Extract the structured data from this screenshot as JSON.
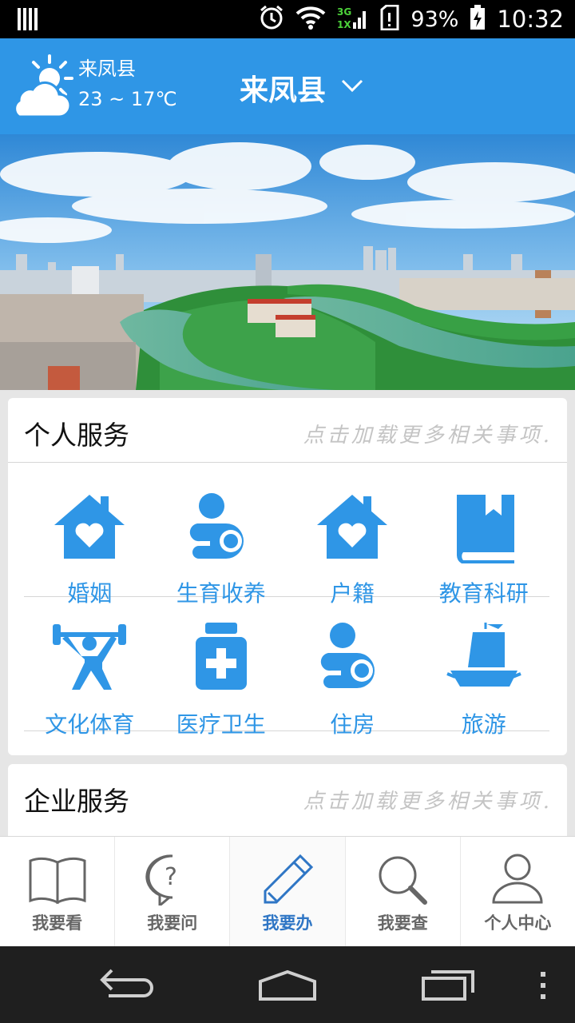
{
  "status_bar": {
    "network": "3G 1X",
    "battery": "93%",
    "time": "10:32"
  },
  "header": {
    "weather": {
      "city": "来凤县",
      "temp": "23 ~ 17℃",
      "icon": "partly-cloudy-icon"
    },
    "location": {
      "selected": "来凤县",
      "icon": "chevron-down-icon"
    }
  },
  "personal_services": {
    "title": "个人服务",
    "more": "点击加载更多相关事项.",
    "items": [
      {
        "label": "婚姻",
        "icon": "house-heart-icon"
      },
      {
        "label": "生育收养",
        "icon": "person-holding-icon"
      },
      {
        "label": "户籍",
        "icon": "house-heart-icon"
      },
      {
        "label": "教育科研",
        "icon": "book-icon"
      },
      {
        "label": "文化体育",
        "icon": "weightlifter-icon"
      },
      {
        "label": "医疗卫生",
        "icon": "medicine-bottle-icon"
      },
      {
        "label": "住房",
        "icon": "person-holding-icon"
      },
      {
        "label": "旅游",
        "icon": "sailboat-icon"
      }
    ]
  },
  "enterprise_services": {
    "title": "企业服务",
    "more": "点击加载更多相关事项."
  },
  "tabs": [
    {
      "label": "我要看",
      "icon": "open-book-icon",
      "active": false
    },
    {
      "label": "我要问",
      "icon": "question-bubble-icon",
      "active": false
    },
    {
      "label": "我要办",
      "icon": "pencil-icon",
      "active": true
    },
    {
      "label": "我要查",
      "icon": "magnifier-icon",
      "active": false
    },
    {
      "label": "个人中心",
      "icon": "person-icon",
      "active": false
    }
  ],
  "colors": {
    "accent": "#2f96e6",
    "header_bg": "#2f96e6",
    "active_tab": "#2f76c5"
  }
}
